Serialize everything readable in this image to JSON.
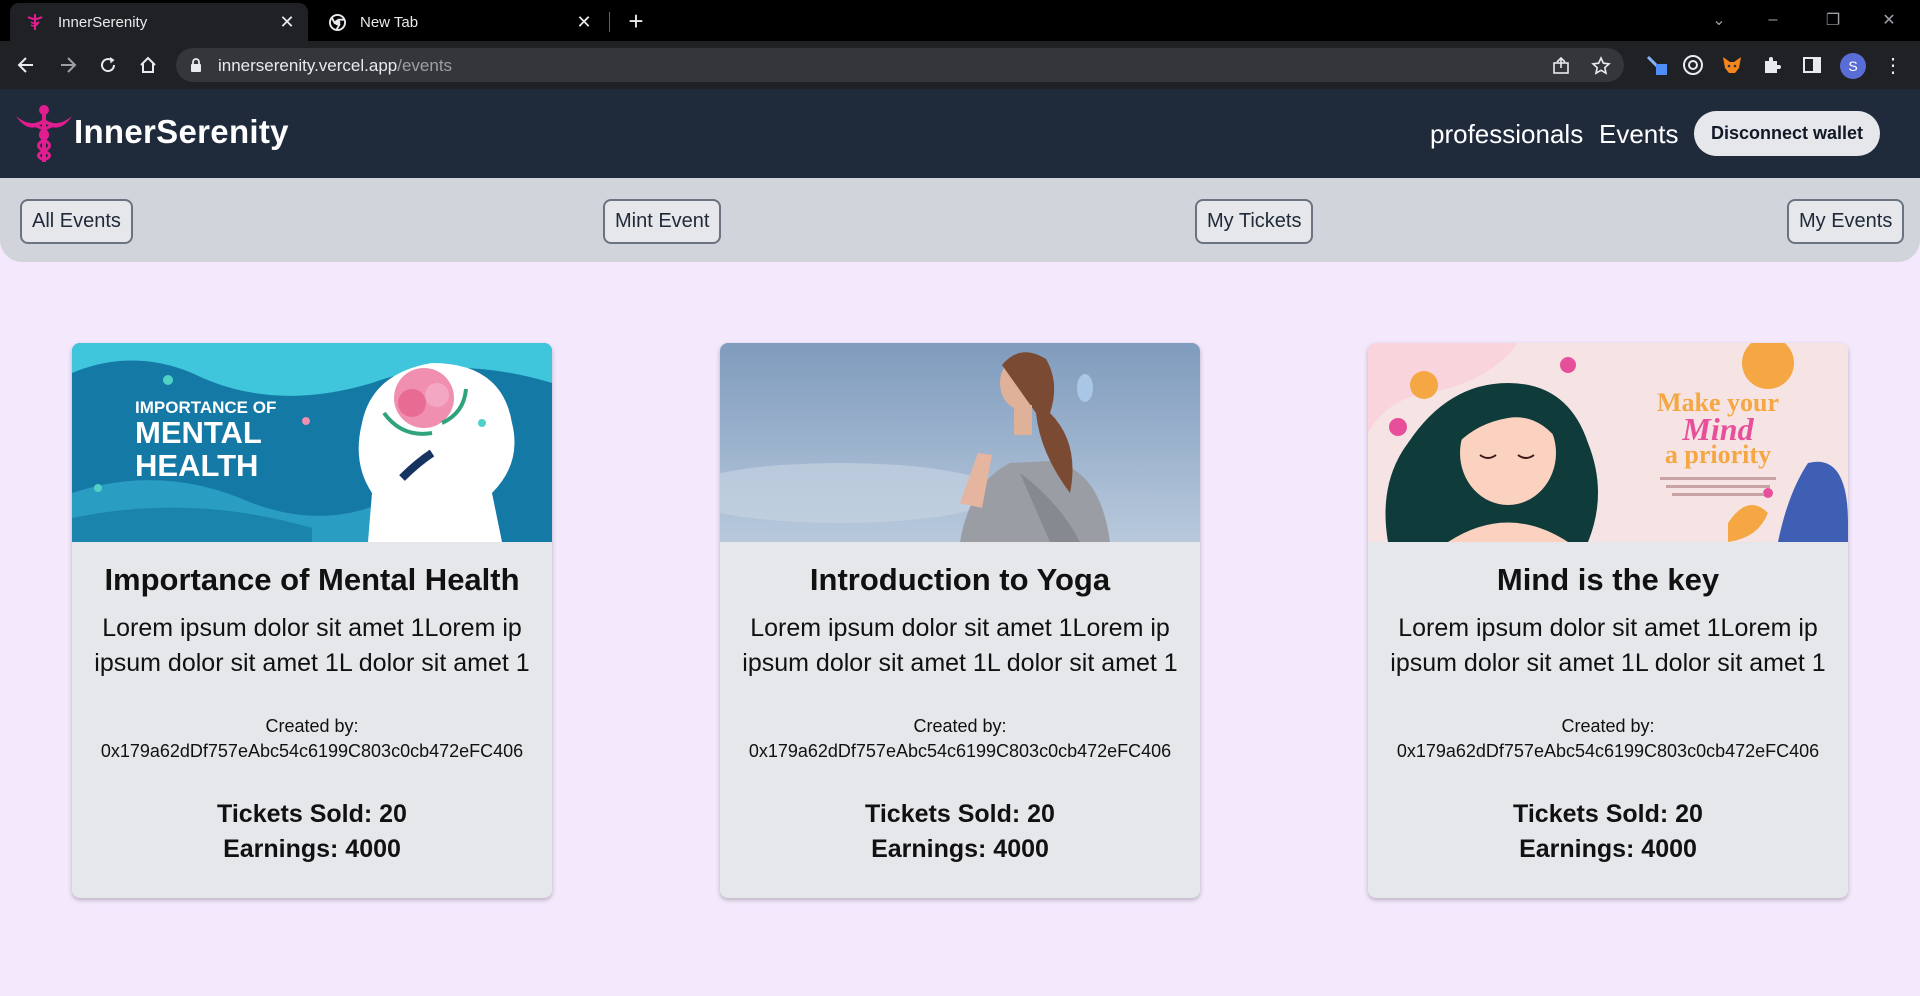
{
  "browser": {
    "tabs": [
      {
        "title": "InnerSerenity",
        "active": true
      },
      {
        "title": "New Tab",
        "active": false
      }
    ],
    "url_host": "innerserenity.vercel.app",
    "url_path": "/events",
    "profile_initial": "S"
  },
  "header": {
    "brand": "InnerSerenity",
    "nav": [
      "professionals",
      "Events"
    ],
    "wallet_button": "Disconnect wallet"
  },
  "subnav": [
    "All Events",
    "Mint Event",
    "My Tickets",
    "My Events"
  ],
  "events": [
    {
      "title": "Importance of Mental Health",
      "description": "Lorem ipsum dolor sit amet 1Lorem ip ipsum dolor sit amet 1L dolor sit amet 1",
      "created_by_label": "Created by:",
      "creator": "0x179a62dDf757eAbc54c6199C803c0cb472eFC406",
      "tickets": "Tickets Sold: 20",
      "earnings": "Earnings: 4000",
      "image_text": [
        "IMPORTANCE OF",
        "MENTAL",
        "HEALTH"
      ]
    },
    {
      "title": "Introduction to Yoga",
      "description": "Lorem ipsum dolor sit amet 1Lorem ip ipsum dolor sit amet 1L dolor sit amet 1",
      "created_by_label": "Created by:",
      "creator": "0x179a62dDf757eAbc54c6199C803c0cb472eFC406",
      "tickets": "Tickets Sold: 20",
      "earnings": "Earnings: 4000"
    },
    {
      "title": "Mind is the key",
      "description": "Lorem ipsum dolor sit amet 1Lorem ip ipsum dolor sit amet 1L dolor sit amet 1",
      "created_by_label": "Created by:",
      "creator": "0x179a62dDf757eAbc54c6199C803c0cb472eFC406",
      "tickets": "Tickets Sold: 20",
      "earnings": "Earnings: 4000",
      "image_text": [
        "Make your",
        "Mind",
        "a priority"
      ]
    }
  ],
  "colors": {
    "page_bg": "#f4e8fd",
    "header_bg": "#1f2a3b",
    "subnav_bg": "#d1d5db",
    "card_bg": "#e5e7eb",
    "brand_accent": "#e11d8f"
  }
}
